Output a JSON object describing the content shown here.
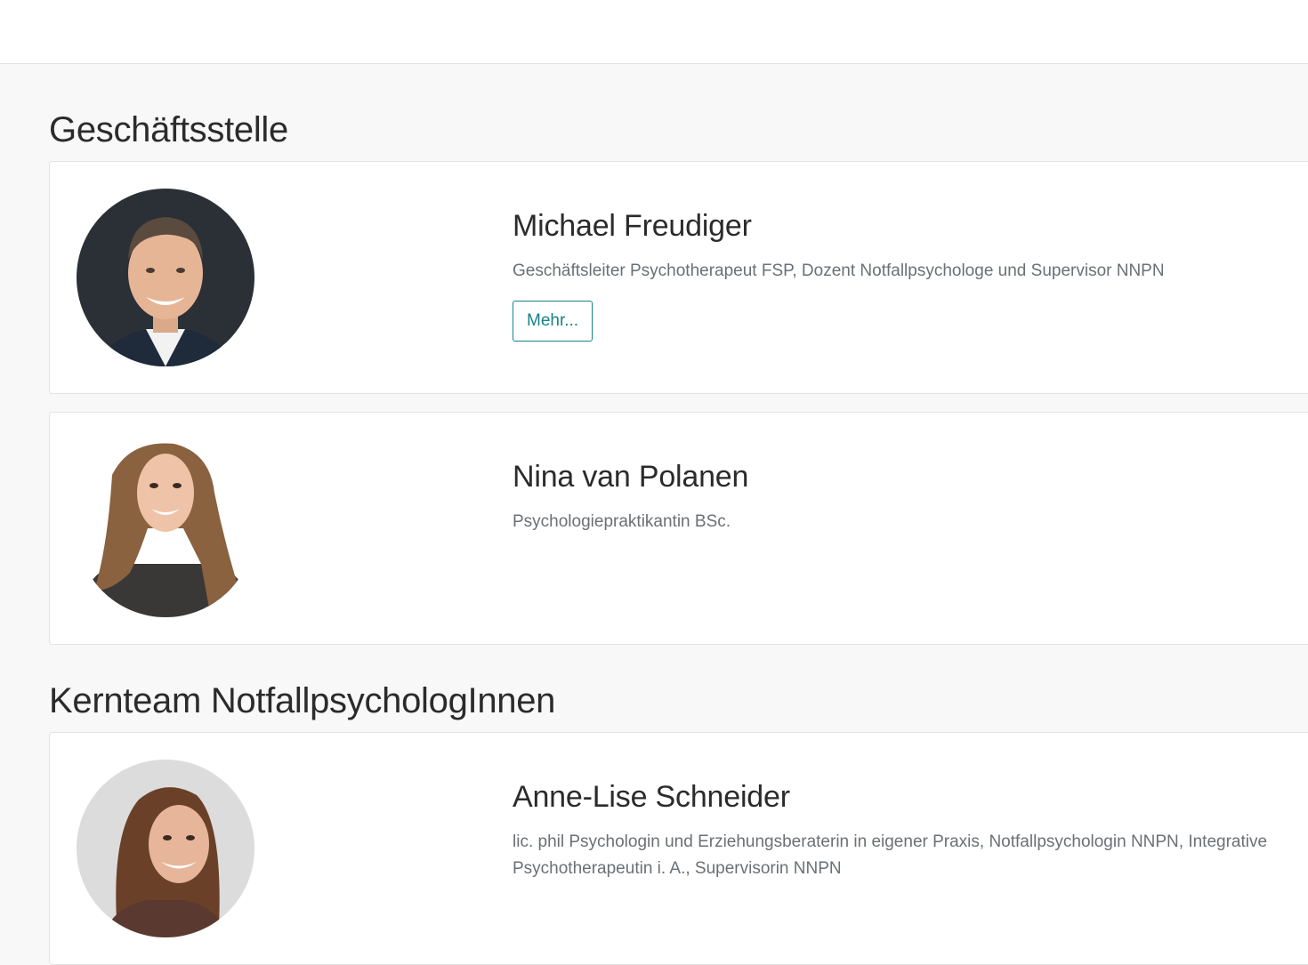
{
  "sections": [
    {
      "title": "Geschäftsstelle",
      "people": [
        {
          "name": "Michael Freudiger",
          "role": "Geschäftsleiter Psychotherapeut FSP, Dozent Notfallpsychologe und Supervisor NNPN",
          "button": "Mehr..."
        },
        {
          "name": "Nina van Polanen",
          "role": "Psychologiepraktikantin BSc."
        }
      ]
    },
    {
      "title": "Kernteam NotfallpsychologInnen",
      "people": [
        {
          "name": "Anne-Lise Schneider",
          "role": "lic. phil Psychologin und Erziehungsberaterin in eigener Praxis, Notfallpsychologin NNPN, Integrative Psychotherapeutin i. A., Supervisorin NNPN"
        }
      ]
    }
  ],
  "colors": {
    "accent": "#17828a",
    "muted_text": "#6b7075",
    "background": "#f8f8f8"
  }
}
